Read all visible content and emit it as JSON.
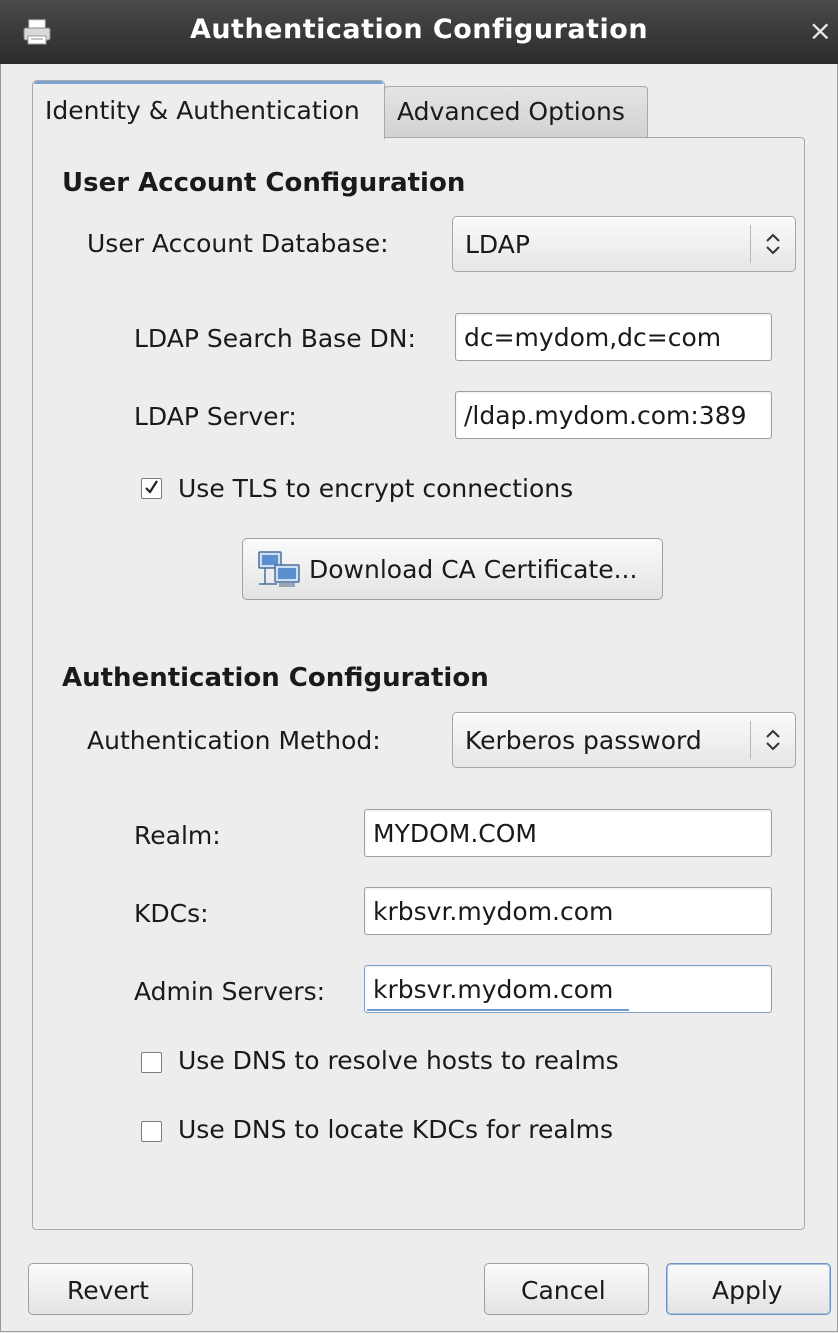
{
  "window": {
    "title": "Authentication Configuration",
    "close_glyph": "×",
    "app_icon": "printer-icon"
  },
  "tabs": [
    {
      "label": "Identity & Authentication",
      "selected": true
    },
    {
      "label": "Advanced Options",
      "selected": false
    }
  ],
  "user_account": {
    "heading": "User Account Configuration",
    "database_label": "User Account Database:",
    "database_value": "LDAP",
    "search_base_label": "LDAP Search Base DN:",
    "search_base_value": "dc=mydom,dc=com",
    "server_label": "LDAP Server:",
    "server_value": "/ldap.mydom.com:389",
    "tls_label": "Use TLS to encrypt connections",
    "tls_checked": true,
    "download_label": "Download CA Certificate...",
    "download_icon": "network-computers-icon"
  },
  "authentication": {
    "heading": "Authentication Configuration",
    "method_label": "Authentication Method:",
    "method_value": "Kerberos password",
    "realm_label": "Realm:",
    "realm_value": "MYDOM.COM",
    "kdcs_label": "KDCs:",
    "kdcs_value": "krbsvr.mydom.com",
    "admin_label": "Admin Servers:",
    "admin_value": "krbsvr.mydom.com",
    "dns_hosts_label": "Use DNS to resolve hosts to realms",
    "dns_hosts_checked": false,
    "dns_kdcs_label": "Use DNS to locate KDCs for realms",
    "dns_kdcs_checked": false
  },
  "footer": {
    "revert_label": "Revert",
    "cancel_label": "Cancel",
    "apply_label": "Apply"
  },
  "colors": {
    "titlebar": "#2b2b2b",
    "focus_accent": "#6e9bd1"
  }
}
